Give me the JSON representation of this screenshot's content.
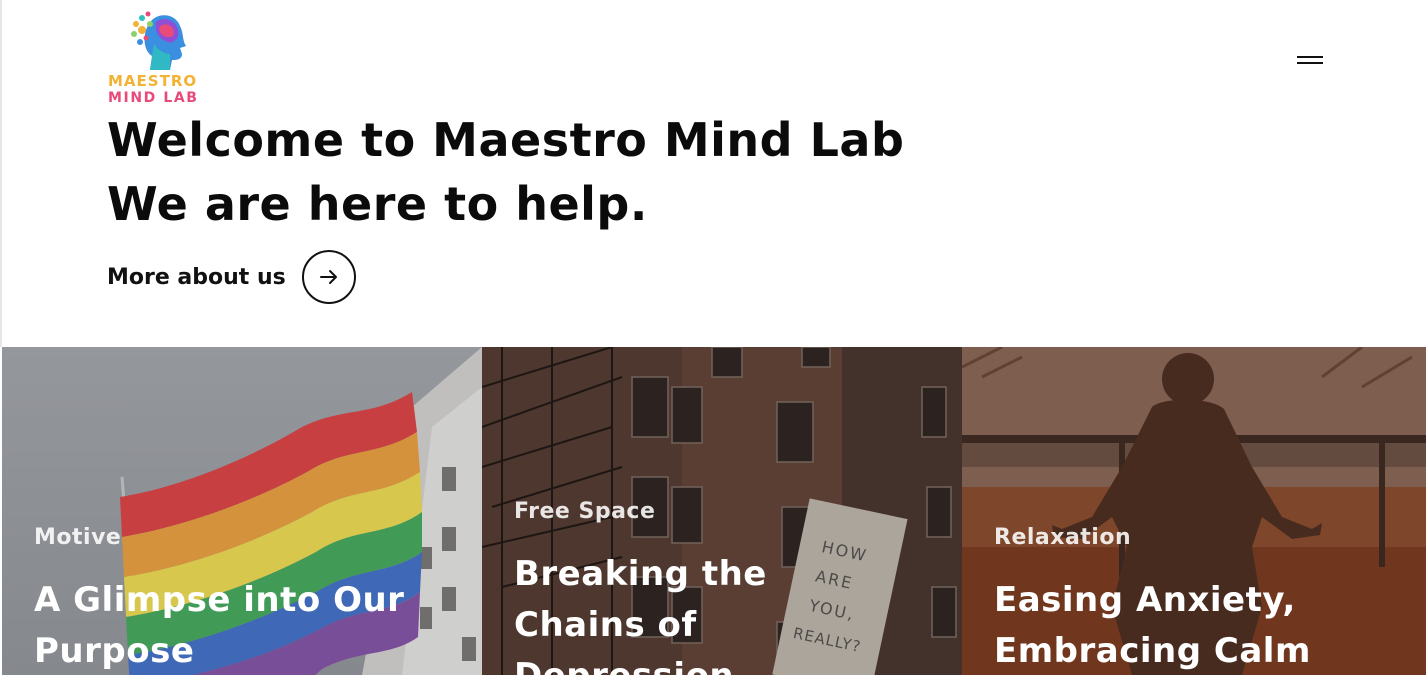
{
  "brand": {
    "logo_line1": "MAESTRO",
    "logo_line2": "MIND LAB",
    "colors": {
      "yellow": "#f2b233",
      "pink": "#e84a7a",
      "blue": "#3b8fe0",
      "purple": "#8e4fd6",
      "teal": "#2fc0c0"
    }
  },
  "header": {
    "menu_icon": "hamburger-menu-icon"
  },
  "hero": {
    "line1": "Welcome to Maestro Mind Lab",
    "line2": "We are here to help.",
    "cta_label": "More about us",
    "cta_icon": "arrow-right-icon"
  },
  "cards": [
    {
      "category": "Motive",
      "title_line1": "A Glimpse into Our",
      "title_line2": "Purpose",
      "image": "rainbow-flag-photo"
    },
    {
      "category": "Free Space",
      "title_line1": "Breaking the",
      "title_line2": "Chains of",
      "title_line3": "Depression",
      "image": "brick-building-photo",
      "sign_text": [
        "HOW",
        "ARE",
        "YOU,",
        "REALLY?"
      ]
    },
    {
      "category": "Relaxation",
      "title_line1": "Easing Anxiety,",
      "title_line2": "Embracing Calm",
      "image": "meditation-sunset-photo"
    }
  ]
}
